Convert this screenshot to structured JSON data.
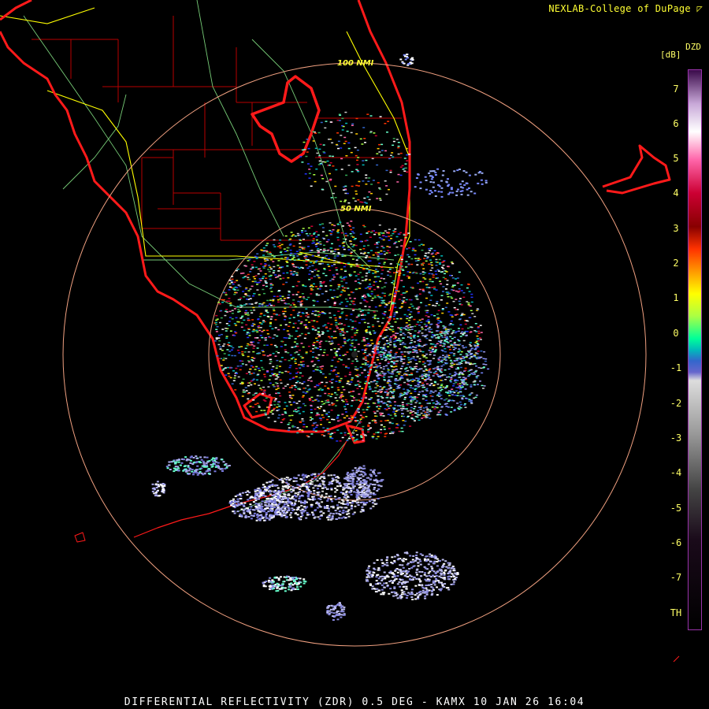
{
  "credit": "NEXLAB-College of DuPage",
  "footer": "DIFFERENTIAL REFLECTIVITY (ZDR) 0.5 DEG - KAMX 10 JAN 26 16:04",
  "legend": {
    "product": "DZD",
    "unit": "[dB]",
    "ticks": [
      "7",
      "6",
      "5",
      "4",
      "3",
      "2",
      "1",
      "0",
      "-1",
      "-2",
      "-3",
      "-4",
      "-5",
      "-6",
      "-7",
      "TH"
    ]
  },
  "rings": {
    "inner": "50 NMI",
    "outer": "100 NMI"
  },
  "radar_site": "KAMX",
  "colors": {
    "coast": "#ff1a1a",
    "county": "#cc0000",
    "highway": "#ffff00",
    "road": "#77cc77",
    "ring": "#f0a080"
  }
}
